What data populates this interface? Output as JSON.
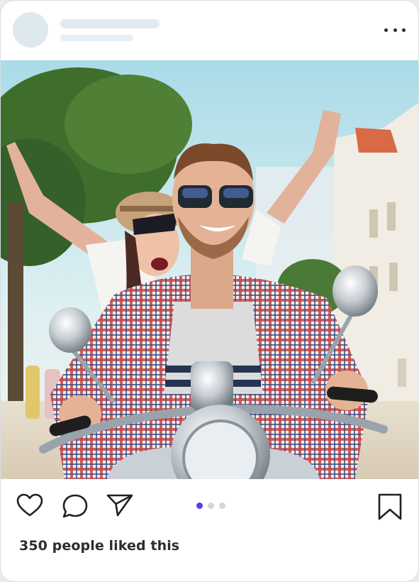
{
  "post": {
    "likes_text": "350 people liked this",
    "carousel": {
      "count": 3,
      "active_index": 0
    },
    "icons": {
      "more": "more-horizontal-icon",
      "like": "heart-icon",
      "comment": "comment-bubble-icon",
      "share": "send-paper-plane-icon",
      "save": "bookmark-icon"
    },
    "colors": {
      "active_dot": "#5b39e8",
      "inactive_dot": "#d2d6db",
      "placeholder": "#dde8ef"
    }
  }
}
